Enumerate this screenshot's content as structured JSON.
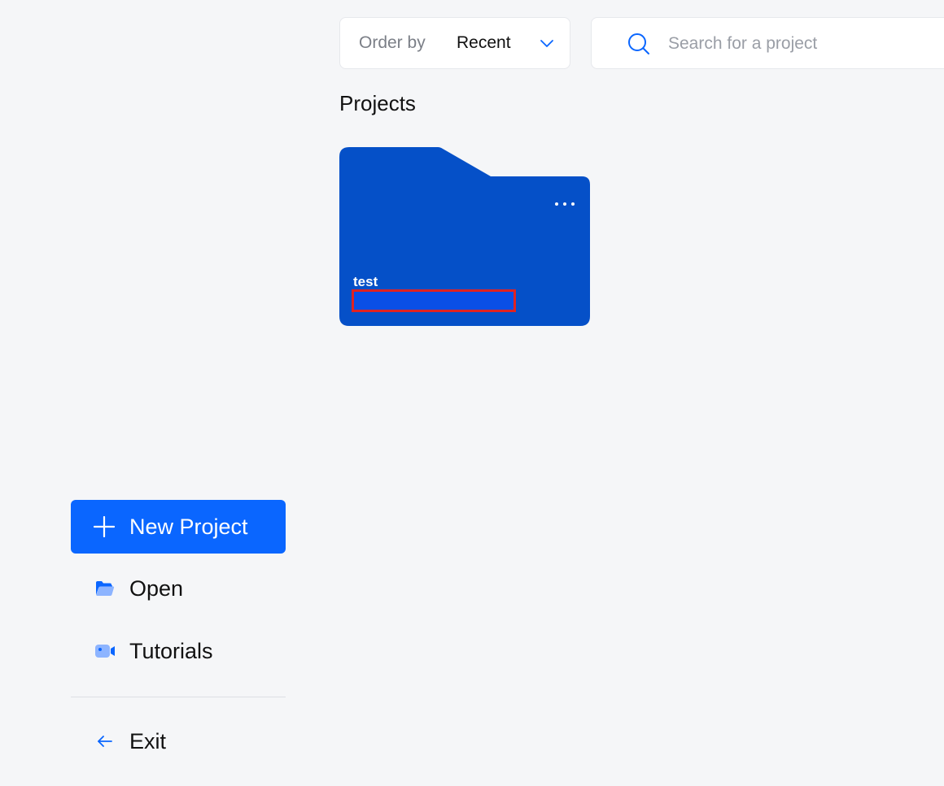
{
  "toolbar": {
    "order_label": "Order by",
    "order_value": "Recent",
    "search_placeholder": "Search for a project"
  },
  "projects": {
    "title": "Projects",
    "items": [
      {
        "name": "test"
      }
    ]
  },
  "sidebar": {
    "new_project_label": "New Project",
    "open_label": "Open",
    "tutorials_label": "Tutorials",
    "exit_label": "Exit"
  },
  "icons": {
    "order": "chevron-down-icon",
    "search": "search-icon",
    "card_menu": "more-horizontal-icon",
    "new_project": "plus-icon",
    "open": "folder-open-icon",
    "tutorials": "video-camera-icon",
    "exit": "arrow-left-icon"
  },
  "colors": {
    "accent": "#0a66ff",
    "card_blue": "#0550c8",
    "highlight_border": "#e02222",
    "background": "#f5f6f8"
  }
}
